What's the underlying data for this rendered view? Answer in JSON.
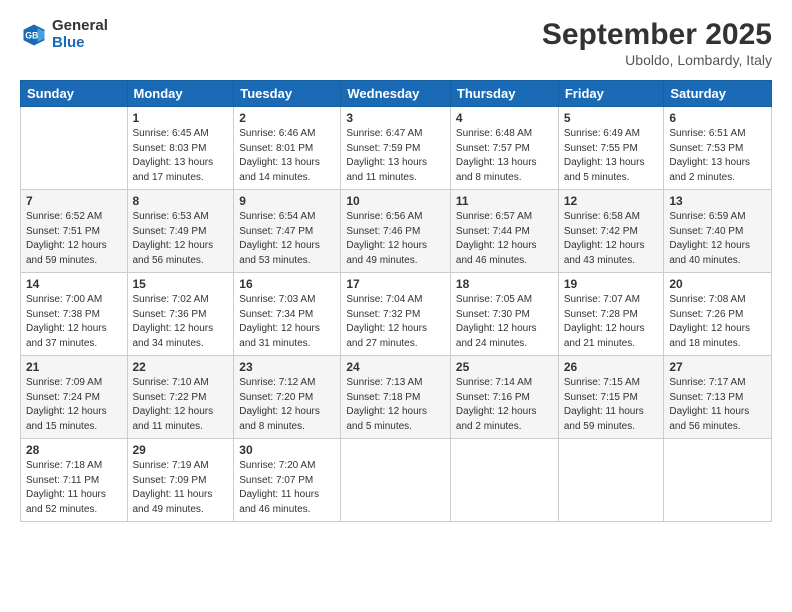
{
  "header": {
    "logo": {
      "line1": "General",
      "line2": "Blue"
    },
    "title": "September 2025",
    "location": "Uboldo, Lombardy, Italy"
  },
  "columns": [
    "Sunday",
    "Monday",
    "Tuesday",
    "Wednesday",
    "Thursday",
    "Friday",
    "Saturday"
  ],
  "weeks": [
    [
      {
        "day": "",
        "info": ""
      },
      {
        "day": "1",
        "info": "Sunrise: 6:45 AM\nSunset: 8:03 PM\nDaylight: 13 hours\nand 17 minutes."
      },
      {
        "day": "2",
        "info": "Sunrise: 6:46 AM\nSunset: 8:01 PM\nDaylight: 13 hours\nand 14 minutes."
      },
      {
        "day": "3",
        "info": "Sunrise: 6:47 AM\nSunset: 7:59 PM\nDaylight: 13 hours\nand 11 minutes."
      },
      {
        "day": "4",
        "info": "Sunrise: 6:48 AM\nSunset: 7:57 PM\nDaylight: 13 hours\nand 8 minutes."
      },
      {
        "day": "5",
        "info": "Sunrise: 6:49 AM\nSunset: 7:55 PM\nDaylight: 13 hours\nand 5 minutes."
      },
      {
        "day": "6",
        "info": "Sunrise: 6:51 AM\nSunset: 7:53 PM\nDaylight: 13 hours\nand 2 minutes."
      }
    ],
    [
      {
        "day": "7",
        "info": "Sunrise: 6:52 AM\nSunset: 7:51 PM\nDaylight: 12 hours\nand 59 minutes."
      },
      {
        "day": "8",
        "info": "Sunrise: 6:53 AM\nSunset: 7:49 PM\nDaylight: 12 hours\nand 56 minutes."
      },
      {
        "day": "9",
        "info": "Sunrise: 6:54 AM\nSunset: 7:47 PM\nDaylight: 12 hours\nand 53 minutes."
      },
      {
        "day": "10",
        "info": "Sunrise: 6:56 AM\nSunset: 7:46 PM\nDaylight: 12 hours\nand 49 minutes."
      },
      {
        "day": "11",
        "info": "Sunrise: 6:57 AM\nSunset: 7:44 PM\nDaylight: 12 hours\nand 46 minutes."
      },
      {
        "day": "12",
        "info": "Sunrise: 6:58 AM\nSunset: 7:42 PM\nDaylight: 12 hours\nand 43 minutes."
      },
      {
        "day": "13",
        "info": "Sunrise: 6:59 AM\nSunset: 7:40 PM\nDaylight: 12 hours\nand 40 minutes."
      }
    ],
    [
      {
        "day": "14",
        "info": "Sunrise: 7:00 AM\nSunset: 7:38 PM\nDaylight: 12 hours\nand 37 minutes."
      },
      {
        "day": "15",
        "info": "Sunrise: 7:02 AM\nSunset: 7:36 PM\nDaylight: 12 hours\nand 34 minutes."
      },
      {
        "day": "16",
        "info": "Sunrise: 7:03 AM\nSunset: 7:34 PM\nDaylight: 12 hours\nand 31 minutes."
      },
      {
        "day": "17",
        "info": "Sunrise: 7:04 AM\nSunset: 7:32 PM\nDaylight: 12 hours\nand 27 minutes."
      },
      {
        "day": "18",
        "info": "Sunrise: 7:05 AM\nSunset: 7:30 PM\nDaylight: 12 hours\nand 24 minutes."
      },
      {
        "day": "19",
        "info": "Sunrise: 7:07 AM\nSunset: 7:28 PM\nDaylight: 12 hours\nand 21 minutes."
      },
      {
        "day": "20",
        "info": "Sunrise: 7:08 AM\nSunset: 7:26 PM\nDaylight: 12 hours\nand 18 minutes."
      }
    ],
    [
      {
        "day": "21",
        "info": "Sunrise: 7:09 AM\nSunset: 7:24 PM\nDaylight: 12 hours\nand 15 minutes."
      },
      {
        "day": "22",
        "info": "Sunrise: 7:10 AM\nSunset: 7:22 PM\nDaylight: 12 hours\nand 11 minutes."
      },
      {
        "day": "23",
        "info": "Sunrise: 7:12 AM\nSunset: 7:20 PM\nDaylight: 12 hours\nand 8 minutes."
      },
      {
        "day": "24",
        "info": "Sunrise: 7:13 AM\nSunset: 7:18 PM\nDaylight: 12 hours\nand 5 minutes."
      },
      {
        "day": "25",
        "info": "Sunrise: 7:14 AM\nSunset: 7:16 PM\nDaylight: 12 hours\nand 2 minutes."
      },
      {
        "day": "26",
        "info": "Sunrise: 7:15 AM\nSunset: 7:15 PM\nDaylight: 11 hours\nand 59 minutes."
      },
      {
        "day": "27",
        "info": "Sunrise: 7:17 AM\nSunset: 7:13 PM\nDaylight: 11 hours\nand 56 minutes."
      }
    ],
    [
      {
        "day": "28",
        "info": "Sunrise: 7:18 AM\nSunset: 7:11 PM\nDaylight: 11 hours\nand 52 minutes."
      },
      {
        "day": "29",
        "info": "Sunrise: 7:19 AM\nSunset: 7:09 PM\nDaylight: 11 hours\nand 49 minutes."
      },
      {
        "day": "30",
        "info": "Sunrise: 7:20 AM\nSunset: 7:07 PM\nDaylight: 11 hours\nand 46 minutes."
      },
      {
        "day": "",
        "info": ""
      },
      {
        "day": "",
        "info": ""
      },
      {
        "day": "",
        "info": ""
      },
      {
        "day": "",
        "info": ""
      }
    ]
  ]
}
